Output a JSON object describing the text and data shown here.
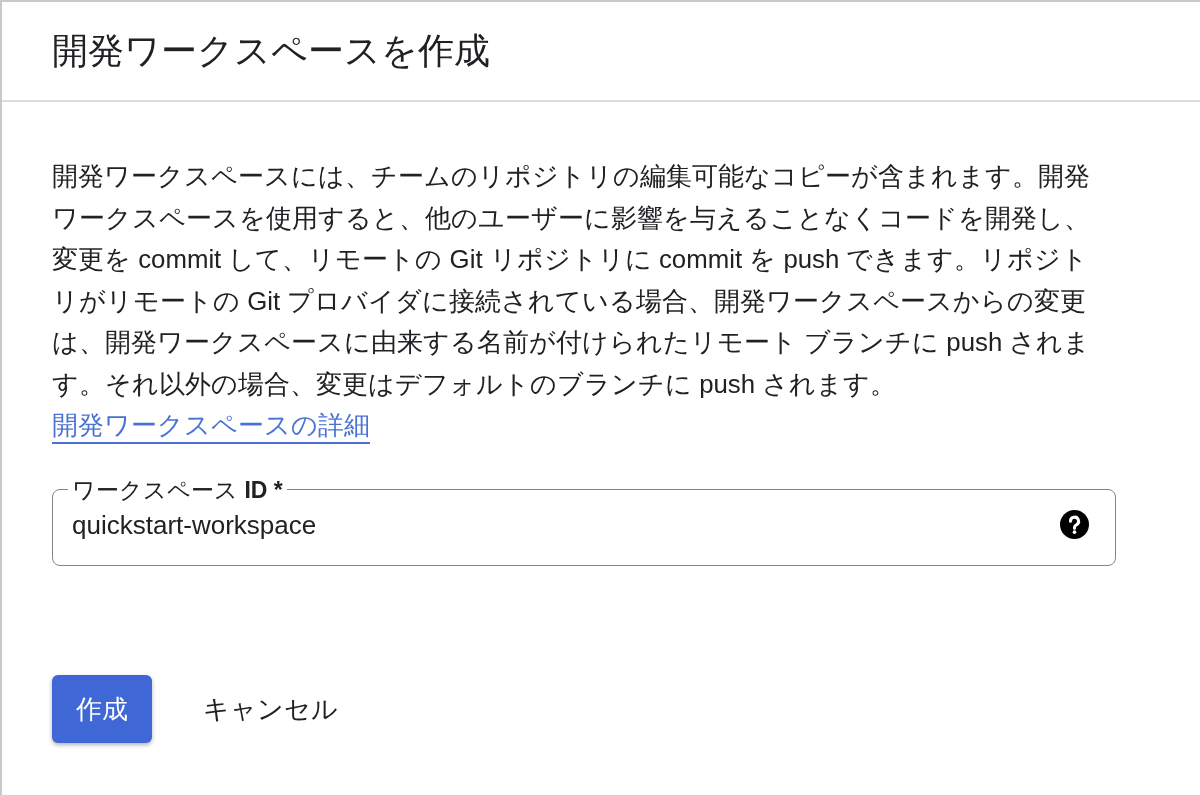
{
  "dialog": {
    "title": "開発ワークスペースを作成",
    "description": {
      "text": "開発ワークスペースには、チームのリポジトリの編集可能なコピーが含まれます。開発ワークスペースを使用すると、他のユーザーに影響を与えることなくコードを開発し、変更を commit して、リモートの Git リポジトリに commit を push できます。リポジトリがリモートの Git プロバイダに接続されている場合、開発ワークスペースからの変更は、開発ワークスペースに由来する名前が付けられたリモート ブランチに push されます。それ以外の場合、変更はデフォルトのブランチに push されます。",
      "link": "開発ワークスペースの詳細"
    },
    "field": {
      "label": "ワークスペース **ID**",
      "required_mark": "*",
      "value": "quickstart-workspace"
    },
    "buttons": [
      {
        "label": "作成",
        "kind": "primary"
      },
      {
        "label": "キャンセル",
        "kind": "text"
      }
    ]
  }
}
